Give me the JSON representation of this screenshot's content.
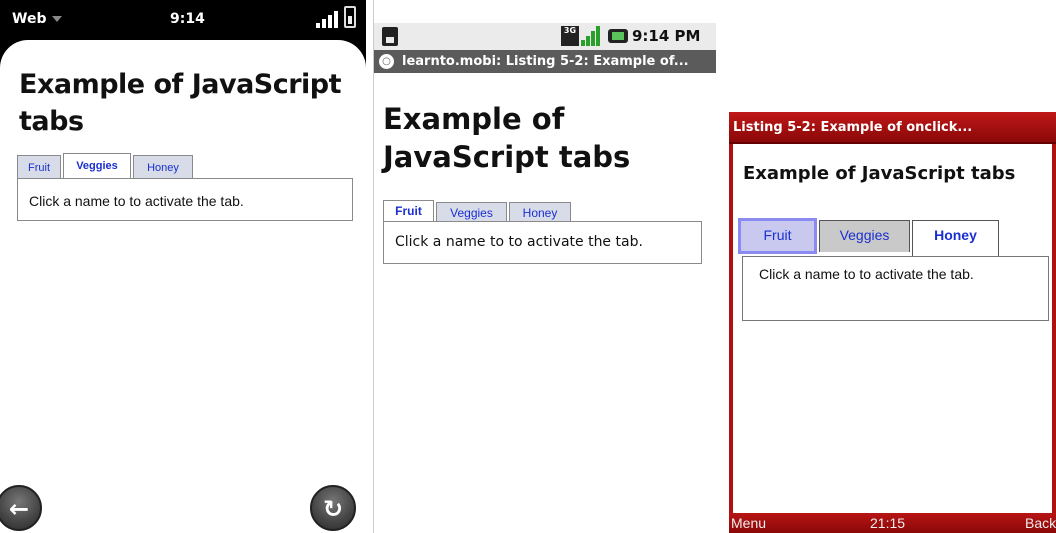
{
  "phone_webos": {
    "status": {
      "app": "Web",
      "time": "9:14"
    },
    "page": {
      "heading": "Example of JavaScript tabs",
      "tabs": [
        "Fruit",
        "Veggies",
        "Honey"
      ],
      "active_tab": "Veggies",
      "content": "Click a name to to activate the tab."
    },
    "buttons": {
      "back_icon": "back-arrow-icon",
      "reload_icon": "reload-icon"
    }
  },
  "phone_android": {
    "status": {
      "network": "3G",
      "time": "9:14 PM"
    },
    "url_bar": {
      "title": "learnto.mobi: Listing 5-2: Example of..."
    },
    "page": {
      "heading": "Example of JavaScript tabs",
      "tabs": [
        "Fruit",
        "Veggies",
        "Honey"
      ],
      "active_tab": "Fruit",
      "content": "Click a name to to activate the tab."
    }
  },
  "phone_opera": {
    "title_bar": "Listing 5-2: Example of onclick...",
    "page": {
      "heading": "Example of JavaScript tabs",
      "tabs": [
        "Fruit",
        "Veggies",
        "Honey"
      ],
      "active_tab": "Honey",
      "focused_tab": "Fruit",
      "content": "Click a name to to activate the tab."
    },
    "softkeys": {
      "left": "Menu",
      "center": "21:15",
      "right": "Back"
    }
  }
}
